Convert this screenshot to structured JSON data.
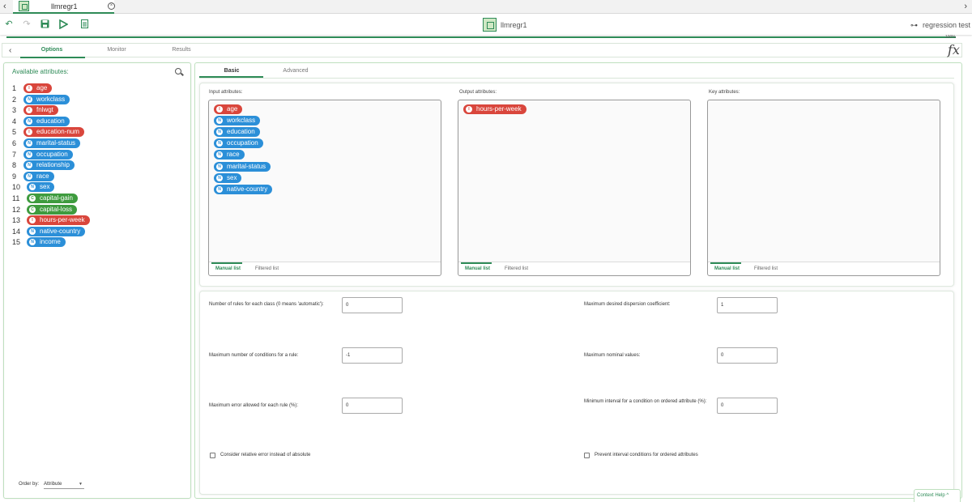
{
  "tabstrip": {
    "doc_tab_label": "llmregr1"
  },
  "toolbar": {
    "workflow_name": "llmregr1",
    "run_target_label": "regression test",
    "progress_label": "100%",
    "progress_fraction": 1.0
  },
  "options_tabs": [
    "Options",
    "Monitor",
    "Results"
  ],
  "fx_label": "fx",
  "left_panel": {
    "title": "Available attributes:",
    "attributes": [
      {
        "num": "1",
        "name": "age",
        "type": "I"
      },
      {
        "num": "2",
        "name": "workclass",
        "type": "N"
      },
      {
        "num": "3",
        "name": "fnlwgt",
        "type": "I"
      },
      {
        "num": "4",
        "name": "education",
        "type": "N"
      },
      {
        "num": "5",
        "name": "education-num",
        "type": "I"
      },
      {
        "num": "6",
        "name": "marital-status",
        "type": "N"
      },
      {
        "num": "7",
        "name": "occupation",
        "type": "N"
      },
      {
        "num": "8",
        "name": "relationship",
        "type": "N"
      },
      {
        "num": "9",
        "name": "race",
        "type": "N"
      },
      {
        "num": "10",
        "name": "sex",
        "type": "N"
      },
      {
        "num": "11",
        "name": "capital-gain",
        "type": "C"
      },
      {
        "num": "12",
        "name": "capital-loss",
        "type": "C"
      },
      {
        "num": "13",
        "name": "hours-per-week",
        "type": "I"
      },
      {
        "num": "14",
        "name": "native-country",
        "type": "N"
      },
      {
        "num": "15",
        "name": "income",
        "type": "N"
      }
    ],
    "order_by_label": "Order by:",
    "order_by_value": "Attribute"
  },
  "sub_tabs": [
    "Basic",
    "Advanced"
  ],
  "attribute_lists": {
    "input": {
      "title": "Input attributes:",
      "items": [
        {
          "name": "age",
          "type": "I"
        },
        {
          "name": "workclass",
          "type": "N"
        },
        {
          "name": "education",
          "type": "N"
        },
        {
          "name": "occupation",
          "type": "N"
        },
        {
          "name": "race",
          "type": "N"
        },
        {
          "name": "marital-status",
          "type": "N"
        },
        {
          "name": "sex",
          "type": "N"
        },
        {
          "name": "native-country",
          "type": "N"
        }
      ]
    },
    "output": {
      "title": "Output attributes:",
      "items": [
        {
          "name": "hours-per-week",
          "type": "I"
        }
      ]
    },
    "key": {
      "title": "Key attributes:",
      "items": []
    },
    "footer_tabs": [
      "Manual list",
      "Filtered list"
    ]
  },
  "params": {
    "rules_per_class": {
      "label": "Number of rules for each class (0 means 'automatic'):",
      "value": "0"
    },
    "max_conditions": {
      "label": "Maximum number of conditions for a rule:",
      "value": "-1"
    },
    "max_error": {
      "label": "Maximum error allowed for each rule (%):",
      "value": "0"
    },
    "max_dispersion": {
      "label": "Maximum desired dispersion coefficient:",
      "value": "1"
    },
    "max_nominal": {
      "label": "Maximum nominal values:",
      "value": "0"
    },
    "min_interval": {
      "label": "Minimum interval for a condition on ordered attribute (%):",
      "value": "0"
    },
    "relative_error": {
      "label": "Consider relative error instead of absolute",
      "checked": false
    },
    "prevent_interval": {
      "label": "Prevent interval conditions for ordered attributes",
      "checked": false
    }
  },
  "context_help": "Context Help"
}
